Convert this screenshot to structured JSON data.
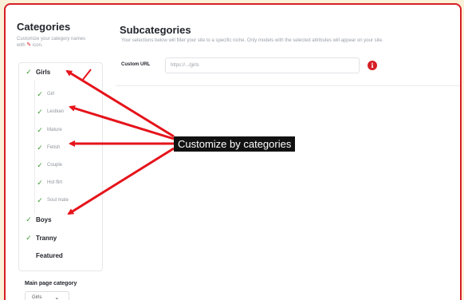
{
  "sidebar": {
    "title": "Categories",
    "description_pre": "Customize your category names with",
    "description_post": "icon.",
    "categories": [
      {
        "label": "Girls",
        "checked": true
      },
      {
        "label": "Boys",
        "checked": true
      },
      {
        "label": "Tranny",
        "checked": true
      },
      {
        "label": "Featured",
        "checked": false
      }
    ],
    "subcategories": [
      {
        "label": "Girl",
        "checked": true
      },
      {
        "label": "Lesbian",
        "checked": true
      },
      {
        "label": "Mature",
        "checked": true
      },
      {
        "label": "Fetish",
        "checked": true
      },
      {
        "label": "Couple",
        "checked": true
      },
      {
        "label": "Hot flirt",
        "checked": true
      },
      {
        "label": "Soul mate",
        "checked": true
      }
    ],
    "main_page_category": {
      "label": "Main page category",
      "selected": "Girls"
    }
  },
  "main": {
    "title": "Subcategories",
    "description": "Your selections below will filter your site to a specific niche. Only models with the selected attributes will appear on your site.",
    "custom_url_label": "Custom URL",
    "custom_url_value": "https://.../girls",
    "info_icon": "i"
  },
  "annotation": {
    "text": "Customize by categories"
  },
  "colors": {
    "accent": "#d61f26",
    "check": "#3a9a2e",
    "background": "#fbf1d8"
  }
}
